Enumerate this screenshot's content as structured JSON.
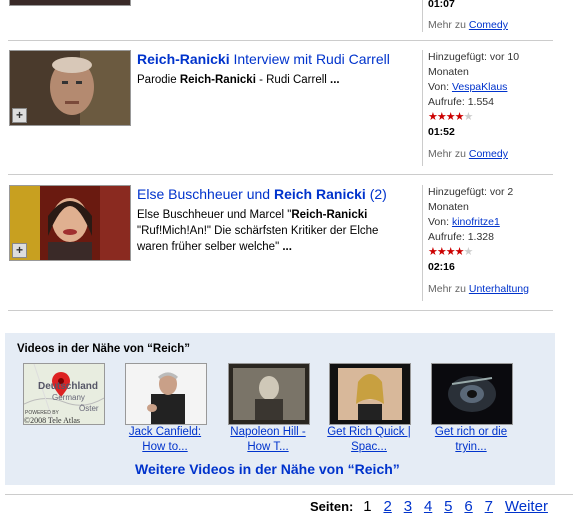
{
  "top": {
    "duration": "01:07",
    "more_prefix": "Mehr zu",
    "more_link": "Comedy"
  },
  "videos": [
    {
      "title_bold": "Reich-Ranicki",
      "title_rest": " Interview mit Rudi Carrell",
      "desc_pre": "Parodie ",
      "desc_bold": "Reich-Ranicki",
      "desc_post": " - Rudi Carrell ",
      "desc_end": "...",
      "added_label": "Hinzugefügt:",
      "added": "vor 10",
      "added2": "Monaten",
      "from_label": "Von:",
      "user": "VespaKlaus",
      "views_label": "Aufrufe:",
      "views": "1.554",
      "rating": 4,
      "duration": "01:52",
      "more_prefix": "Mehr zu",
      "category": "Comedy"
    },
    {
      "title_pre": "Else Buschheuer und ",
      "title_bold": "Reich Ranicki",
      "title_post": " (2)",
      "desc1_pre": "Else Buschheuer und Marcel \"",
      "desc1_bold": "Reich-Ranicki",
      "desc2": "\"Ruf!Mich!An!\" Die schärfsten Kritiker der Elche",
      "desc3": "waren früher selber welche\" ",
      "desc_end": "...",
      "added_label": "Hinzugefügt:",
      "added": "vor 2",
      "added2": "Monaten",
      "from_label": "Von:",
      "user": "kinofritze1",
      "views_label": "Aufrufe:",
      "views": "1.328",
      "rating": 4,
      "duration": "02:16",
      "more_prefix": "Mehr zu",
      "category": "Unterhaltung"
    }
  ],
  "nearby": {
    "heading": "Videos in der Nähe von “Reich”",
    "map_labels": [
      "Deutschland",
      "Germany",
      "Öster",
      "POWERED BY",
      "©2008 Tele Atlas"
    ],
    "items": [
      {
        "line1": "Jack Canfield:",
        "line2": "How to..."
      },
      {
        "line1": "Napoleon Hill -",
        "line2": "How T..."
      },
      {
        "line1": "Get Rich Quick |",
        "line2": "Spac..."
      },
      {
        "line1": "Get rich or die",
        "line2": "tryin..."
      }
    ],
    "more": "Weitere Videos in der Nähe von “Reich”"
  },
  "pager": {
    "label": "Seiten:",
    "current": "1",
    "pages": [
      "2",
      "3",
      "4",
      "5",
      "6",
      "7"
    ],
    "next": "Weiter"
  }
}
